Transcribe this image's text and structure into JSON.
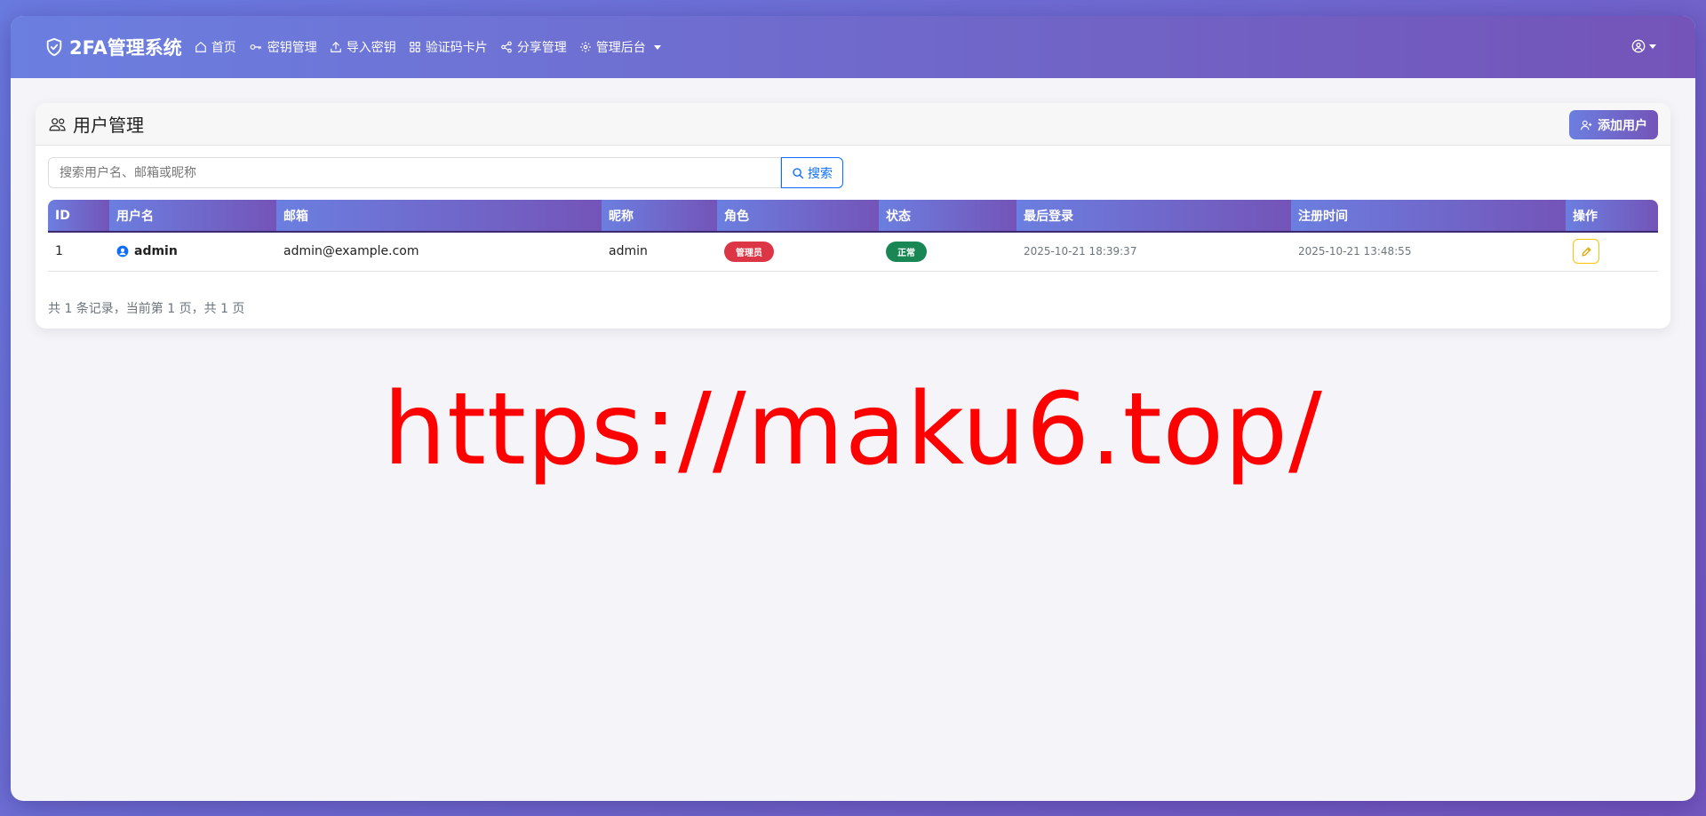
{
  "navbar": {
    "brand": "2FA管理系统",
    "items": [
      {
        "label": "首页",
        "icon": "house-icon"
      },
      {
        "label": "密钥管理",
        "icon": "key-icon"
      },
      {
        "label": "导入密钥",
        "icon": "upload-icon"
      },
      {
        "label": "验证码卡片",
        "icon": "grid-icon"
      },
      {
        "label": "分享管理",
        "icon": "share-icon"
      },
      {
        "label": "管理后台",
        "icon": "gear-icon",
        "dropdown": true
      }
    ],
    "user_menu_icon": "person-circle-icon"
  },
  "card": {
    "title": "用户管理",
    "add_button": "添加用户"
  },
  "search": {
    "placeholder": "搜索用户名、邮箱或昵称",
    "value": "",
    "button": "搜索"
  },
  "table": {
    "headers": [
      "ID",
      "用户名",
      "邮箱",
      "昵称",
      "角色",
      "状态",
      "最后登录",
      "注册时间",
      "操作"
    ],
    "rows": [
      {
        "id": "1",
        "username": "admin",
        "email": "admin@example.com",
        "nickname": "admin",
        "role": "管理员",
        "status": "正常",
        "last_login": "2025-10-21 18:39:37",
        "registered": "2025-10-21 13:48:55"
      }
    ]
  },
  "pagination_info": "共 1 条记录，当前第 1 页，共 1 页",
  "watermark": "https://maku6.top/",
  "colors": {
    "accent_start": "#6b7fe0",
    "accent_end": "#7454b8",
    "role_badge": "#dc3545",
    "status_badge": "#198754",
    "search_btn": "#0d6efd",
    "edit_btn": "#ffc107",
    "watermark": "#ff0000"
  }
}
